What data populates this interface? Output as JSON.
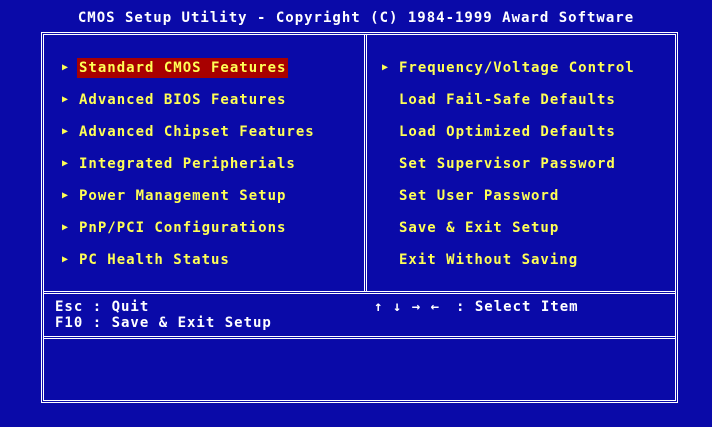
{
  "title": "CMOS Setup Utility - Copyright (C) 1984-1999 Award Software",
  "left_menu": [
    {
      "label": "Standard CMOS Features",
      "submenu": true,
      "selected": true
    },
    {
      "label": "Advanced BIOS Features",
      "submenu": true,
      "selected": false
    },
    {
      "label": "Advanced Chipset Features",
      "submenu": true,
      "selected": false
    },
    {
      "label": "Integrated Peripherials",
      "submenu": true,
      "selected": false
    },
    {
      "label": "Power Management Setup",
      "submenu": true,
      "selected": false
    },
    {
      "label": "PnP/PCI Configurations",
      "submenu": true,
      "selected": false
    },
    {
      "label": "PC Health Status",
      "submenu": true,
      "selected": false
    }
  ],
  "right_menu": [
    {
      "label": "Frequency/Voltage Control",
      "submenu": true
    },
    {
      "label": "Load Fail-Safe Defaults",
      "submenu": false
    },
    {
      "label": "Load Optimized Defaults",
      "submenu": false
    },
    {
      "label": "Set Supervisor Password",
      "submenu": false
    },
    {
      "label": "Set User Password",
      "submenu": false
    },
    {
      "label": "Save & Exit Setup",
      "submenu": false
    },
    {
      "label": "Exit Without Saving",
      "submenu": false
    }
  ],
  "keys": {
    "esc": "Esc : Quit",
    "f10": "F10 : Save & Exit Setup",
    "arrows": "↑ ↓ → ←",
    "select": ": Select Item"
  },
  "colors": {
    "background": "#0a0aa8",
    "menu_text": "#ffff55",
    "highlight": "#a80000",
    "frame": "#ffffff"
  }
}
